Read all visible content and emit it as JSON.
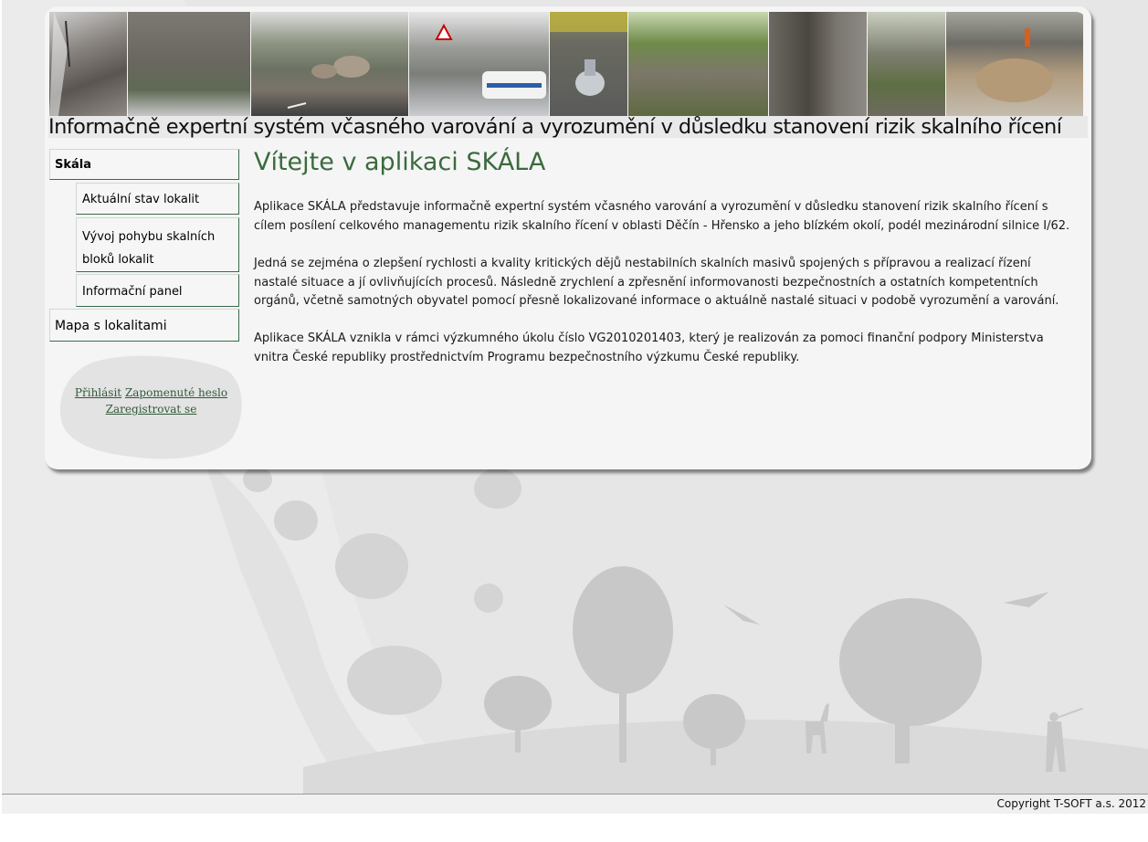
{
  "banner": {
    "title": "Informačně expertní systém včasného varování a vyrozumění v důsledku stanovení rizik skalního řícení",
    "photos": [
      "rock-tree",
      "rock-wall-road",
      "rockfall-road",
      "police-car-road",
      "survey-marker",
      "mossy-rocks",
      "rock-face",
      "rock-pillars",
      "boulder-road"
    ]
  },
  "sidebar": {
    "items": [
      {
        "label": "Skála",
        "bold": true
      },
      {
        "label": "Aktuální stav lokalit"
      },
      {
        "label": "Vývoj pohybu skalních bloků lokalit"
      },
      {
        "label": "Informační panel"
      },
      {
        "label": "Mapa s lokalitami"
      }
    ],
    "login": {
      "login_label": "Přihlásit",
      "forgot_label": "Zapomenuté heslo",
      "register_label": "Zaregistrovat se"
    }
  },
  "main": {
    "title": "Vítejte v aplikaci SKÁLA",
    "paragraphs": [
      "Aplikace SKÁLA představuje informačně expertní systém včasného varování a vyrozumění v důsledku stanovení rizik skalního řícení s cílem posílení celkového managementu rizik skalního řícení v oblasti Děčín - Hřensko a jeho blízkém okolí, podél mezinárodní silnice I/62.",
      "Jedná se zejména o zlepšení rychlosti a kvality kritických dějů nestabilních skalních masivů spojených s přípravou a realizací řízení nastalé situace a jí ovlivňujících procesů. Následně zrychlení a zpřesnění informovanosti bezpečnostních a ostatních kompetentních orgánů, včetně samotných obyvatel pomocí přesně lokalizované informace o aktuálně nastalé situaci v podobě vyrozumění a varování.",
      "Aplikace SKÁLA vznikla v rámci výzkumného úkolu číslo VG2010201403, který je realizován za pomoci finanční podpory Ministerstva vnitra České republiky prostřednictvím Programu bezpečnostního výzkumu České republiky."
    ]
  },
  "footer": {
    "copyright": "Copyright T-SOFT a.s. 2012"
  },
  "colors": {
    "accent": "#3b6a3e",
    "nav_border": "#3b6a4c",
    "background": "#e6e6e6"
  }
}
